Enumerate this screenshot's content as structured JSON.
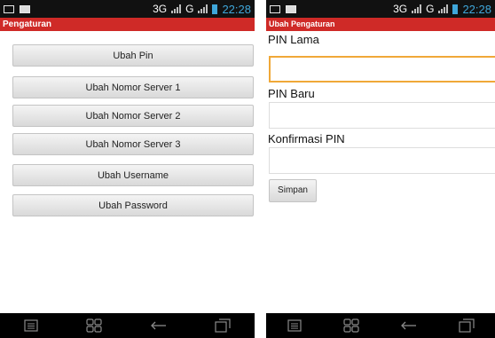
{
  "status_bar": {
    "network_3g": "3G",
    "network_g": "G",
    "time": "22:28"
  },
  "settings_screen": {
    "title": "Pengaturan",
    "buttons": [
      "Ubah Pin",
      "Ubah Nomor Server 1",
      "Ubah Nomor Server 2",
      "Ubah Nomor Server 3",
      "Ubah Username",
      "Ubah Password"
    ]
  },
  "change_screen": {
    "title": "Ubah Pengaturan",
    "old_pin_label": "PIN Lama",
    "new_pin_label": "PIN Baru",
    "confirm_pin_label": "Konfirmasi PIN",
    "save_label": "Simpan"
  },
  "colors": {
    "title_bar": "#cf2a27",
    "status_bar": "#111111",
    "clock": "#3fa6d9",
    "focus_border": "#f0a838"
  },
  "nav_icons": [
    "menu-icon",
    "apps-icon",
    "back-icon",
    "recent-apps-icon"
  ]
}
